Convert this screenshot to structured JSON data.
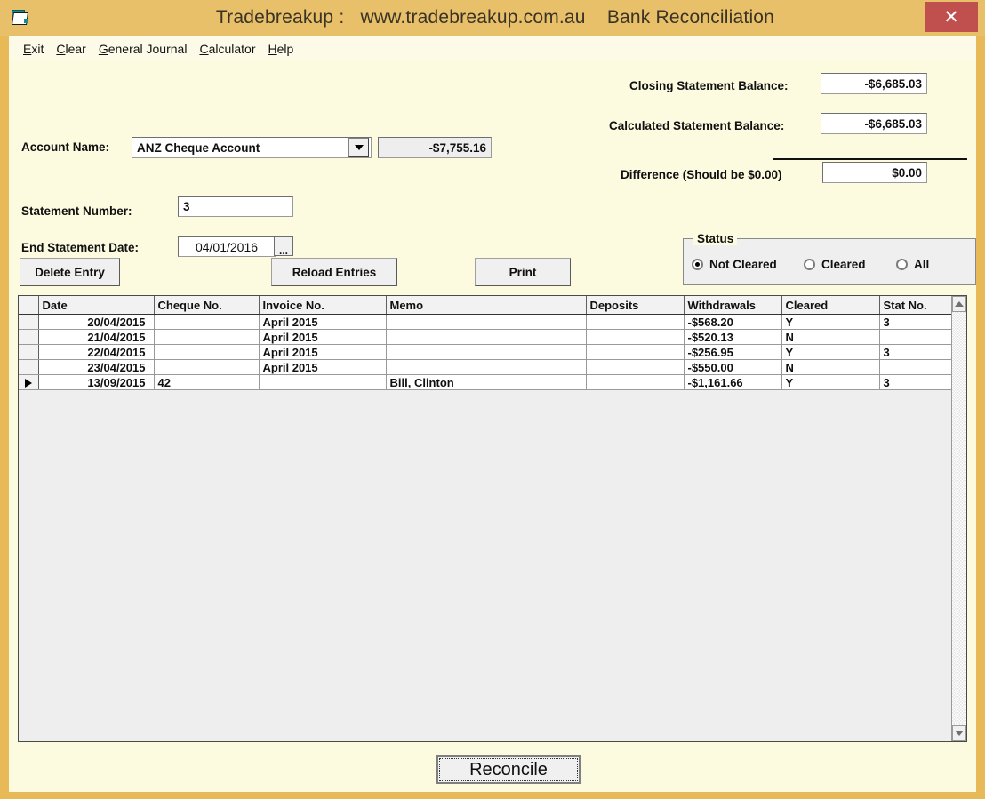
{
  "window": {
    "title": "Tradebreakup :   www.tradebreakup.com.au    Bank Reconciliation",
    "icon": "document-icon",
    "close_label": "✕",
    "titlebar_color": "#e8c069",
    "close_color": "#c0504d",
    "client_color": "#fcfadf"
  },
  "menu": [
    {
      "pre": "",
      "accel": "E",
      "post": "xit"
    },
    {
      "pre": "",
      "accel": "C",
      "post": "lear"
    },
    {
      "pre": "",
      "accel": "G",
      "post": "eneral Journal"
    },
    {
      "pre": "",
      "accel": "C",
      "post": "alculator"
    },
    {
      "pre": "",
      "accel": "H",
      "post": "elp"
    }
  ],
  "form": {
    "account_name_label": "Account Name:",
    "account_name_value": "ANZ Cheque Account",
    "account_balance_value": "-$7,755.16",
    "statement_number_label": "Statement Number:",
    "statement_number_value": "3",
    "end_statement_date_label": "End Statement Date:",
    "end_statement_date_value": "04/01/2016",
    "date_picker_label": "...",
    "closing_balance_label": "Closing Statement Balance:",
    "closing_balance_value": "-$6,685.03",
    "calculated_balance_label": "Calculated Statement Balance:",
    "calculated_balance_value": "-$6,685.03",
    "difference_label": "Difference (Should be $0.00)",
    "difference_value": "$0.00"
  },
  "toolbar": {
    "delete_entry_label": "Delete Entry",
    "reload_entries_label": "Reload Entries",
    "print_label": "Print"
  },
  "status": {
    "legend": "Status",
    "options": [
      {
        "label": "Not Cleared",
        "selected": true
      },
      {
        "label": "Cleared",
        "selected": false
      },
      {
        "label": "All",
        "selected": false
      }
    ]
  },
  "grid": {
    "columns": [
      "Date",
      "Cheque No.",
      "Invoice No.",
      "Memo",
      "Deposits",
      "Withdrawals",
      "Cleared",
      "Stat No."
    ],
    "rows": [
      {
        "selected": false,
        "date": "20/04/2015",
        "cheque_no": "",
        "invoice_no": "April 2015",
        "memo": "",
        "deposits": "",
        "withdrawals": "-$568.20",
        "cleared": "Y",
        "stat_no": "3"
      },
      {
        "selected": false,
        "date": "21/04/2015",
        "cheque_no": "",
        "invoice_no": "April 2015",
        "memo": "",
        "deposits": "",
        "withdrawals": "-$520.13",
        "cleared": "N",
        "stat_no": ""
      },
      {
        "selected": false,
        "date": "22/04/2015",
        "cheque_no": "",
        "invoice_no": "April 2015",
        "memo": "",
        "deposits": "",
        "withdrawals": "-$256.95",
        "cleared": "Y",
        "stat_no": "3"
      },
      {
        "selected": false,
        "date": "23/04/2015",
        "cheque_no": "",
        "invoice_no": "April 2015",
        "memo": "",
        "deposits": "",
        "withdrawals": "-$550.00",
        "cleared": "N",
        "stat_no": ""
      },
      {
        "selected": true,
        "date": "13/09/2015",
        "cheque_no": "42",
        "invoice_no": "",
        "memo": "Bill, Clinton",
        "deposits": "",
        "withdrawals": "-$1,161.66",
        "cleared": "Y",
        "stat_no": "3"
      }
    ],
    "scrollbar": {
      "up": "scroll-up-icon",
      "down": "scroll-down-icon"
    }
  },
  "footer": {
    "reconcile_label": "Reconcile"
  }
}
